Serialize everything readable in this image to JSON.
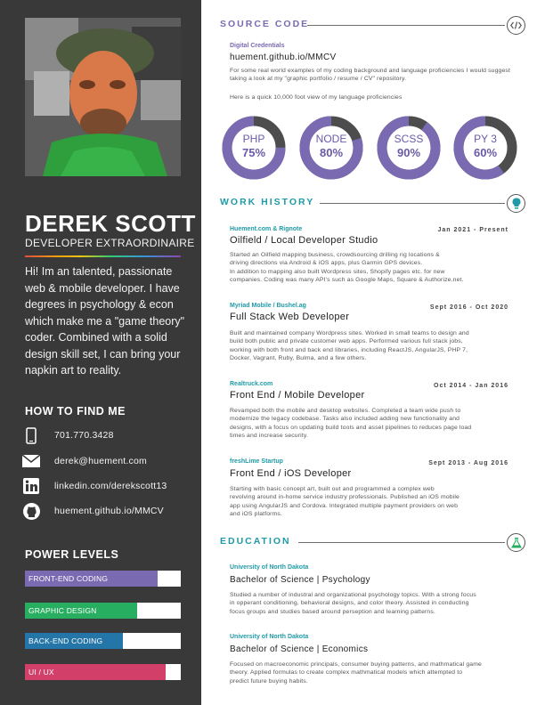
{
  "colors": {
    "sidebar_bg": "#393939",
    "teal": "#1f9aa6",
    "purple": "#7a6ab2",
    "donut_track": "#4d4d4d",
    "donut_fill": "#7a6ab2"
  },
  "profile": {
    "name": "DEREK SCOTT",
    "role": "DEVELOPER EXTRAORDINAIRE",
    "bio": "Hi! Im an talented, passionate web & mobile developer. I have degrees in psychology & econ which make me a \"game theory\" coder. Combined with a solid design skill set, I can bring your napkin art to reality."
  },
  "contact": {
    "heading": "HOW TO FIND ME",
    "items": [
      {
        "icon": "phone-icon",
        "text": "701.770.3428"
      },
      {
        "icon": "mail-icon",
        "text": "derek@huement.com"
      },
      {
        "icon": "linkedin-icon",
        "text": "linkedin.com/derekscott13"
      },
      {
        "icon": "github-icon",
        "text": "huement.github.io/MMCV"
      }
    ]
  },
  "power_levels": {
    "heading": "POWER LEVELS",
    "bars": [
      {
        "label": "FRONT-END CODING",
        "level": 0.85,
        "color": "#7a6ab2"
      },
      {
        "label": "GRAPHIC DESIGN",
        "level": 0.72,
        "color": "#27ae60"
      },
      {
        "label": "BACK-END CODING",
        "level": 0.63,
        "color": "#2576a8"
      },
      {
        "label": "UI / UX",
        "level": 0.9,
        "color": "#d23f68"
      }
    ]
  },
  "source_code": {
    "title": "SOURCE CODE",
    "icon": "code-icon",
    "label": "Digital Credentials",
    "link": "huement.github.io/MMCV",
    "para1": "For some real world examples of my coding background and language proficiencies I would suggest taking a look at my \"graphic portfolio / resume / CV\" repository.",
    "para2": "Here is a quick 10,000 foot view of my language proficiencies",
    "languages": [
      {
        "name": "PHP",
        "percent": "75%",
        "value": 75
      },
      {
        "name": "NODE",
        "percent": "80%",
        "value": 80
      },
      {
        "name": "SCSS",
        "percent": "90%",
        "value": 90
      },
      {
        "name": "PY 3",
        "percent": "60%",
        "value": 60
      }
    ]
  },
  "work_history": {
    "title": "WORK HISTORY",
    "icon": "bulb-icon",
    "jobs": [
      {
        "company": "Huement.com & Rignote",
        "position": "Oilfield / Local Developer Studio",
        "dates": "Jan 2021 - Present",
        "lines": [
          "Started an Oilfield mapping business, crowdsourcing drilling rig locations &",
          "driving directions via Android & iOS apps, plus Garmin GPS devices.",
          "In addition to mapping also built Wordpress sites, Shopify pages etc. for new",
          "companies. Coding was many API's such as Google Maps, Square & Authorize.net."
        ]
      },
      {
        "company": "Myriad Mobile / Bushel.ag",
        "position": "Full Stack Web Developer",
        "dates": "Sept 2016 - Oct 2020",
        "lines": [
          "Built and maintained company Wordpress sites. Worked in small teams to design and",
          "build both public and private customer web apps. Performed various full stack jobs,",
          "working with both front and back end libraries, including ReactJS, AngularJS, PHP 7,",
          "Docker, Vagrant, Ruby, Bulma, and a few others."
        ]
      },
      {
        "company": "Realtruck.com",
        "position": "Front End / Mobile Developer",
        "dates": "Oct 2014 - Jan 2016",
        "lines": [
          "Revamped both the mobile and desktop websites. Completed a team wide push to",
          "modernize the legacy codebase. Tasks also included adding new functionality and",
          "designs, with a focus on updating build tools and asset pipelines to reduces page load",
          "times and increase security."
        ]
      },
      {
        "company": "freshLime Startup",
        "position": "Front End / iOS Developer",
        "dates": "Sept 2013 - Aug 2016",
        "lines": [
          "Starting with basic concept art, built out and programmed a complex web",
          "revolving around in-home service industry professionals. Published an iOS mobile",
          "app using AngularJS and Cordova. Integrated multiple payment providers on web",
          "and iOS platforms."
        ]
      }
    ]
  },
  "education": {
    "title": "EDUCATION",
    "icon": "flask-icon",
    "items": [
      {
        "school": "University of North Dakota",
        "degree": "Bachelor of Science | Psychology",
        "lines": [
          "Studied a number of industral and organizational psychology topics. With a strong focus",
          "in opperant conditioning, behavioral designs, and color theory.  Assisted in conducting",
          "focus groups and studies based around perseption and learning patterns."
        ]
      },
      {
        "school": "University of North Dakota",
        "degree": "Bachelor of Science | Economics",
        "lines": [
          "Focused on macroeconomic principals, consumer buying patterns, and mathmatical game",
          "theory. Applied formulas to create complex mathmatical models which attempted to",
          "predict future buying habits."
        ]
      }
    ]
  }
}
